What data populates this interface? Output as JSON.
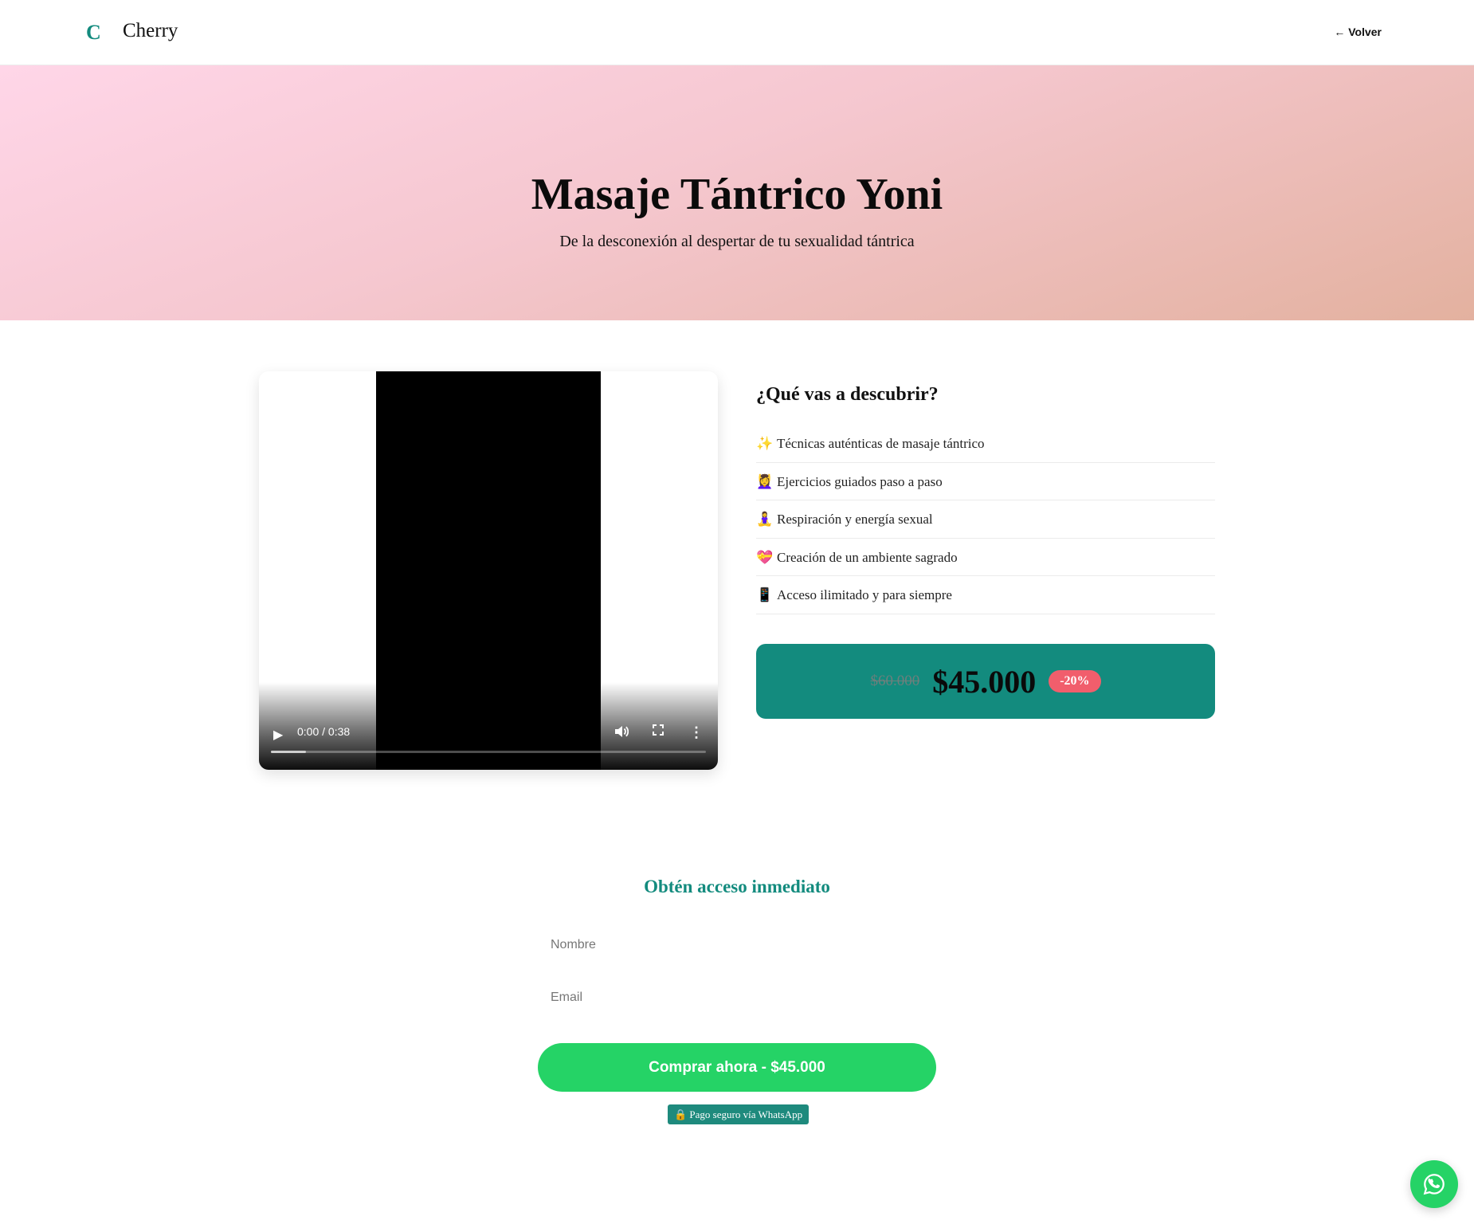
{
  "header": {
    "logo_mark": "C",
    "brand": "Cherry",
    "back_label": "← Volver"
  },
  "hero": {
    "title": "Masaje Tántrico Yoni",
    "subtitle": "De la desconexión al despertar de tu sexualidad tántrica"
  },
  "video": {
    "time": "0:00 / 0:38",
    "progress_fraction": 0.08,
    "icons": [
      "play-icon",
      "volume-icon",
      "fullscreen-icon",
      "more-options-icon"
    ]
  },
  "features": {
    "heading": "¿Qué vas a descubrir?",
    "items": [
      {
        "emoji": "✨",
        "label": "Técnicas auténticas de masaje tántrico"
      },
      {
        "emoji": "💆‍♀️",
        "label": "Ejercicios guiados paso a paso"
      },
      {
        "emoji": "🧘‍♀️",
        "label": "Respiración y energía sexual"
      },
      {
        "emoji": "💝",
        "label": "Creación de un ambiente sagrado"
      },
      {
        "emoji": "📱",
        "label": "Acceso ilimitado y para siempre"
      }
    ]
  },
  "price": {
    "old": "$60.000",
    "current": "$45.000",
    "discount": "-20%"
  },
  "form": {
    "title": "Obtén acceso inmediato",
    "name_placeholder": "Nombre",
    "email_placeholder": "Email",
    "button_label": "Comprar ahora - $45.000",
    "secure_note": "🔒 Pago seguro vía WhatsApp"
  },
  "colors": {
    "teal": "#138b7e",
    "whatsapp_green": "#25d366",
    "discount_red": "#f15e6c"
  },
  "fab": {
    "icon": "whatsapp-icon"
  }
}
